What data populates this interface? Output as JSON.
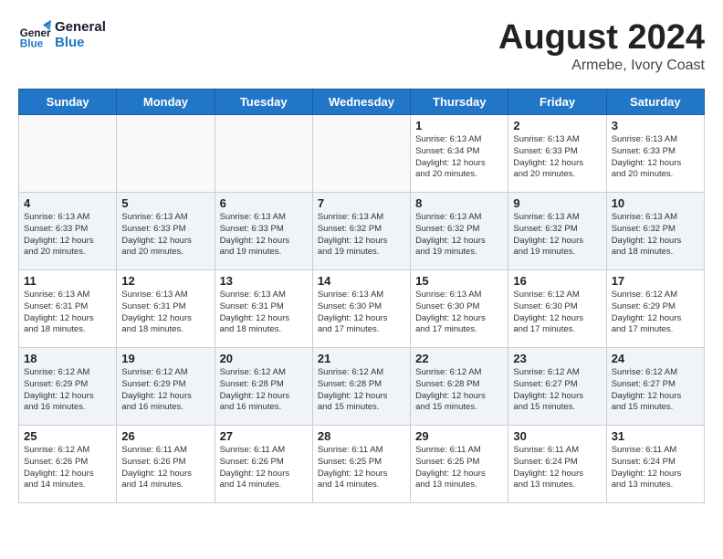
{
  "header": {
    "logo_line1": "General",
    "logo_line2": "Blue",
    "month": "August 2024",
    "location": "Armebe, Ivory Coast"
  },
  "weekdays": [
    "Sunday",
    "Monday",
    "Tuesday",
    "Wednesday",
    "Thursday",
    "Friday",
    "Saturday"
  ],
  "weeks": [
    [
      {
        "day": "",
        "info": ""
      },
      {
        "day": "",
        "info": ""
      },
      {
        "day": "",
        "info": ""
      },
      {
        "day": "",
        "info": ""
      },
      {
        "day": "1",
        "info": "Sunrise: 6:13 AM\nSunset: 6:34 PM\nDaylight: 12 hours\nand 20 minutes."
      },
      {
        "day": "2",
        "info": "Sunrise: 6:13 AM\nSunset: 6:33 PM\nDaylight: 12 hours\nand 20 minutes."
      },
      {
        "day": "3",
        "info": "Sunrise: 6:13 AM\nSunset: 6:33 PM\nDaylight: 12 hours\nand 20 minutes."
      }
    ],
    [
      {
        "day": "4",
        "info": "Sunrise: 6:13 AM\nSunset: 6:33 PM\nDaylight: 12 hours\nand 20 minutes."
      },
      {
        "day": "5",
        "info": "Sunrise: 6:13 AM\nSunset: 6:33 PM\nDaylight: 12 hours\nand 20 minutes."
      },
      {
        "day": "6",
        "info": "Sunrise: 6:13 AM\nSunset: 6:33 PM\nDaylight: 12 hours\nand 19 minutes."
      },
      {
        "day": "7",
        "info": "Sunrise: 6:13 AM\nSunset: 6:32 PM\nDaylight: 12 hours\nand 19 minutes."
      },
      {
        "day": "8",
        "info": "Sunrise: 6:13 AM\nSunset: 6:32 PM\nDaylight: 12 hours\nand 19 minutes."
      },
      {
        "day": "9",
        "info": "Sunrise: 6:13 AM\nSunset: 6:32 PM\nDaylight: 12 hours\nand 19 minutes."
      },
      {
        "day": "10",
        "info": "Sunrise: 6:13 AM\nSunset: 6:32 PM\nDaylight: 12 hours\nand 18 minutes."
      }
    ],
    [
      {
        "day": "11",
        "info": "Sunrise: 6:13 AM\nSunset: 6:31 PM\nDaylight: 12 hours\nand 18 minutes."
      },
      {
        "day": "12",
        "info": "Sunrise: 6:13 AM\nSunset: 6:31 PM\nDaylight: 12 hours\nand 18 minutes."
      },
      {
        "day": "13",
        "info": "Sunrise: 6:13 AM\nSunset: 6:31 PM\nDaylight: 12 hours\nand 18 minutes."
      },
      {
        "day": "14",
        "info": "Sunrise: 6:13 AM\nSunset: 6:30 PM\nDaylight: 12 hours\nand 17 minutes."
      },
      {
        "day": "15",
        "info": "Sunrise: 6:13 AM\nSunset: 6:30 PM\nDaylight: 12 hours\nand 17 minutes."
      },
      {
        "day": "16",
        "info": "Sunrise: 6:12 AM\nSunset: 6:30 PM\nDaylight: 12 hours\nand 17 minutes."
      },
      {
        "day": "17",
        "info": "Sunrise: 6:12 AM\nSunset: 6:29 PM\nDaylight: 12 hours\nand 17 minutes."
      }
    ],
    [
      {
        "day": "18",
        "info": "Sunrise: 6:12 AM\nSunset: 6:29 PM\nDaylight: 12 hours\nand 16 minutes."
      },
      {
        "day": "19",
        "info": "Sunrise: 6:12 AM\nSunset: 6:29 PM\nDaylight: 12 hours\nand 16 minutes."
      },
      {
        "day": "20",
        "info": "Sunrise: 6:12 AM\nSunset: 6:28 PM\nDaylight: 12 hours\nand 16 minutes."
      },
      {
        "day": "21",
        "info": "Sunrise: 6:12 AM\nSunset: 6:28 PM\nDaylight: 12 hours\nand 15 minutes."
      },
      {
        "day": "22",
        "info": "Sunrise: 6:12 AM\nSunset: 6:28 PM\nDaylight: 12 hours\nand 15 minutes."
      },
      {
        "day": "23",
        "info": "Sunrise: 6:12 AM\nSunset: 6:27 PM\nDaylight: 12 hours\nand 15 minutes."
      },
      {
        "day": "24",
        "info": "Sunrise: 6:12 AM\nSunset: 6:27 PM\nDaylight: 12 hours\nand 15 minutes."
      }
    ],
    [
      {
        "day": "25",
        "info": "Sunrise: 6:12 AM\nSunset: 6:26 PM\nDaylight: 12 hours\nand 14 minutes."
      },
      {
        "day": "26",
        "info": "Sunrise: 6:11 AM\nSunset: 6:26 PM\nDaylight: 12 hours\nand 14 minutes."
      },
      {
        "day": "27",
        "info": "Sunrise: 6:11 AM\nSunset: 6:26 PM\nDaylight: 12 hours\nand 14 minutes."
      },
      {
        "day": "28",
        "info": "Sunrise: 6:11 AM\nSunset: 6:25 PM\nDaylight: 12 hours\nand 14 minutes."
      },
      {
        "day": "29",
        "info": "Sunrise: 6:11 AM\nSunset: 6:25 PM\nDaylight: 12 hours\nand 13 minutes."
      },
      {
        "day": "30",
        "info": "Sunrise: 6:11 AM\nSunset: 6:24 PM\nDaylight: 12 hours\nand 13 minutes."
      },
      {
        "day": "31",
        "info": "Sunrise: 6:11 AM\nSunset: 6:24 PM\nDaylight: 12 hours\nand 13 minutes."
      }
    ]
  ]
}
